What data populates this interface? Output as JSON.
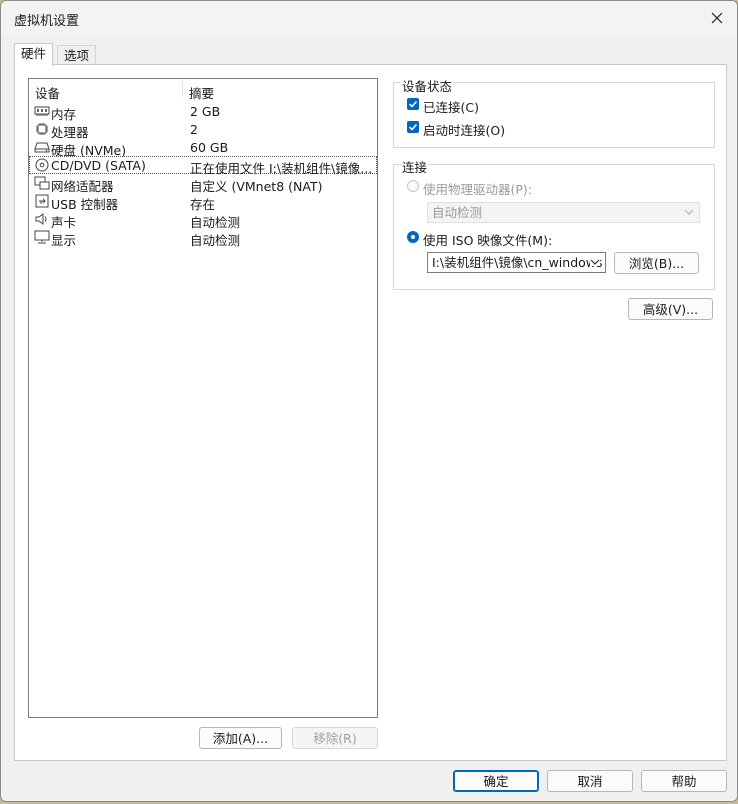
{
  "window": {
    "title": "虚拟机设置"
  },
  "tabs": [
    {
      "label": "硬件"
    },
    {
      "label": "选项"
    }
  ],
  "device_list": {
    "columns": {
      "device": "设备",
      "summary": "摘要"
    },
    "rows": [
      {
        "icon": "memory-icon",
        "name": "内存",
        "summary": "2 GB"
      },
      {
        "icon": "processor-icon",
        "name": "处理器",
        "summary": "2"
      },
      {
        "icon": "hard-disk-icon",
        "name": "硬盘 (NVMe)",
        "summary": "60 GB"
      },
      {
        "icon": "cd-dvd-icon",
        "name": "CD/DVD (SATA)",
        "summary": "正在使用文件 I:\\装机组件\\镜像..."
      },
      {
        "icon": "network-adapter-icon",
        "name": "网络适配器",
        "summary": "自定义 (VMnet8 (NAT)"
      },
      {
        "icon": "usb-icon",
        "name": "USB 控制器",
        "summary": "存在"
      },
      {
        "icon": "speaker-icon",
        "name": "声卡",
        "summary": "自动检测"
      },
      {
        "icon": "display-icon",
        "name": "显示",
        "summary": "自动检测"
      }
    ]
  },
  "list_buttons": {
    "add": "添加(A)...",
    "remove": "移除(R)"
  },
  "device_status": {
    "title": "设备状态",
    "connected": {
      "label": "已连接(C)",
      "checked": true
    },
    "connect_at_power_on": {
      "label": "启动时连接(O)",
      "checked": true
    }
  },
  "connection": {
    "title": "连接",
    "physical_drive": {
      "label": "使用物理驱动器(P):",
      "selected": false,
      "value": "自动检测"
    },
    "iso_image": {
      "label": "使用 ISO 映像文件(M):",
      "selected": true,
      "value": "I:\\装机组件\\镜像\\cn_windows"
    },
    "browse": "浏览(B)..."
  },
  "advanced_button": "高级(V)...",
  "footer": {
    "ok": "确定",
    "cancel": "取消",
    "help": "帮助"
  },
  "colors": {
    "accent": "#0067c0"
  }
}
